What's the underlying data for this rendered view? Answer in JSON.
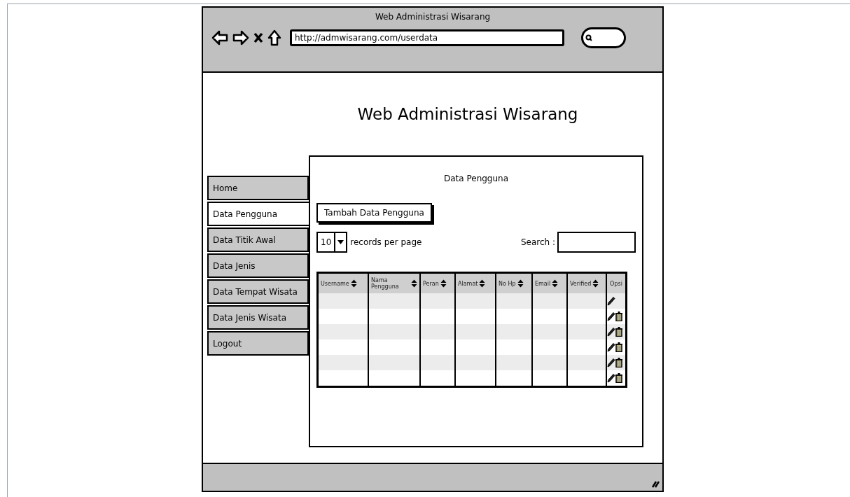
{
  "browser": {
    "title": "Web Administrasi Wisarang",
    "url": "http://admwisarang.com/userdata"
  },
  "heading": "Web Administrasi Wisarang",
  "nav": [
    {
      "label": "Home",
      "selected": false
    },
    {
      "label": "Data Pengguna",
      "selected": true
    },
    {
      "label": "Data Titik Awal",
      "selected": false
    },
    {
      "label": "Data Jenis",
      "selected": false
    },
    {
      "label": "Data Tempat Wisata",
      "selected": false
    },
    {
      "label": "Data Jenis Wisata",
      "selected": false
    },
    {
      "label": "Logout",
      "selected": false
    }
  ],
  "panel": {
    "title": "Data Pengguna",
    "add_button": "Tambah Data Pengguna",
    "page_size": "10",
    "page_size_label": "records per page",
    "search_label": "Search :"
  },
  "table": {
    "columns": [
      {
        "label": "Username",
        "sortable": true
      },
      {
        "label": "Nama Pengguna",
        "sortable": true
      },
      {
        "label": "Peran",
        "sortable": true
      },
      {
        "label": "Alamat",
        "sortable": true
      },
      {
        "label": "No Hp",
        "sortable": true
      },
      {
        "label": "Email",
        "sortable": true
      },
      {
        "label": "Verified",
        "sortable": true
      },
      {
        "label": "Opsi",
        "sortable": false
      }
    ],
    "rows": [
      {
        "deletable": false
      },
      {
        "deletable": true
      },
      {
        "deletable": true
      },
      {
        "deletable": true
      },
      {
        "deletable": true
      },
      {
        "deletable": true
      }
    ]
  }
}
